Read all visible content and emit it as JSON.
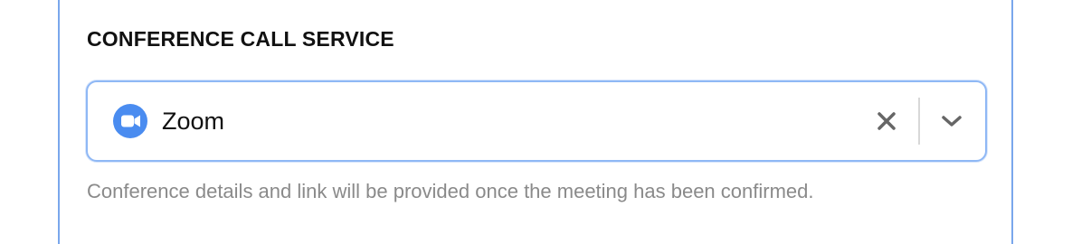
{
  "section": {
    "title": "CONFERENCE CALL SERVICE"
  },
  "select": {
    "value": "Zoom",
    "icon": "zoom-camera-icon",
    "clear_icon": "close-icon",
    "dropdown_icon": "chevron-down-icon"
  },
  "help": {
    "text": "Conference details and link will be provided once the meeting has been confirmed."
  },
  "colors": {
    "accent_border": "#8fb8f5",
    "panel_border": "#7aa7ec",
    "zoom_blue": "#4a8cf0",
    "help_text": "#8a8a8a"
  }
}
